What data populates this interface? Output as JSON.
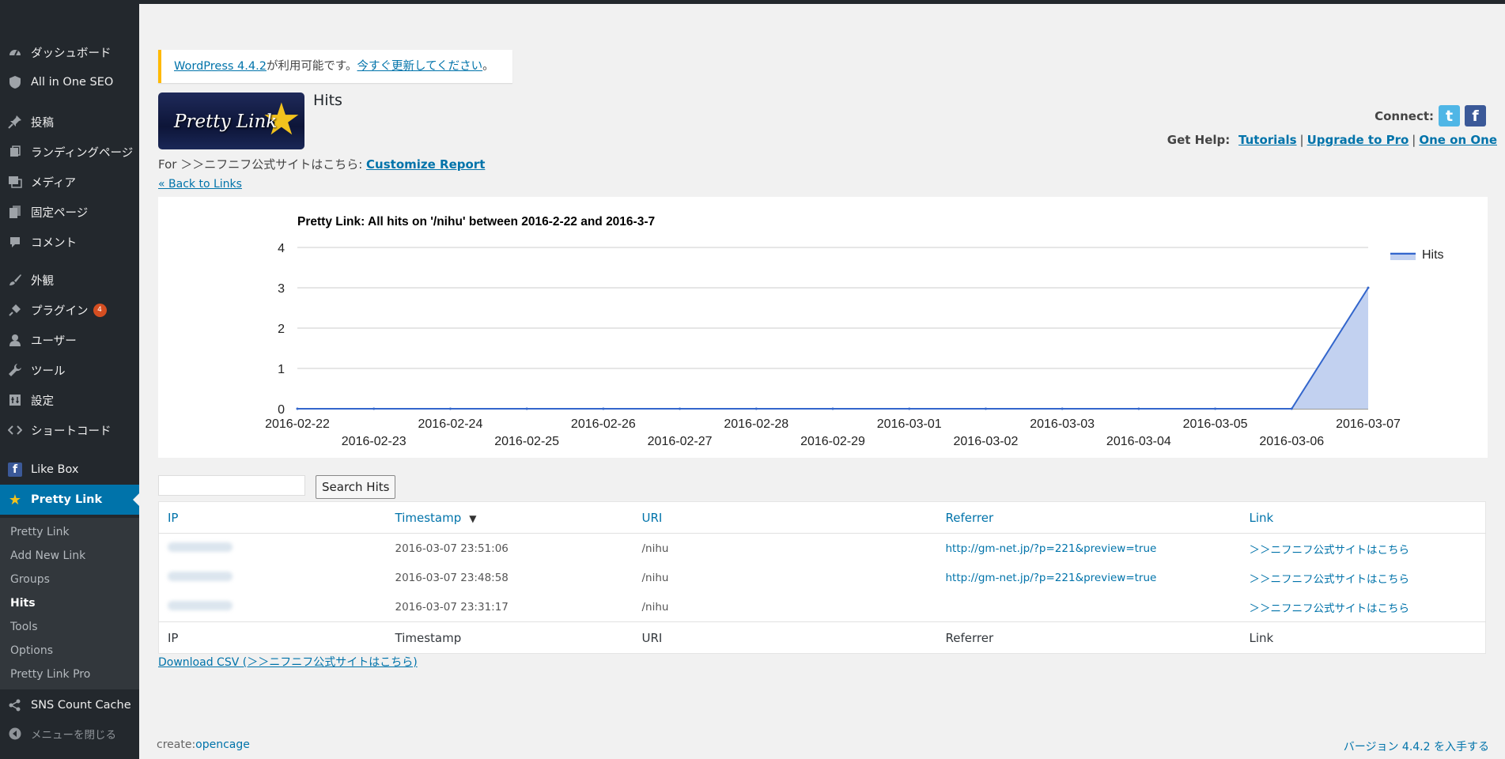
{
  "sidebar": {
    "items": [
      {
        "label": "ダッシュボード",
        "icon": "dashboard-icon"
      },
      {
        "label": "All in One SEO",
        "icon": "shield-icon"
      },
      {
        "label": "投稿",
        "icon": "pushpin-icon"
      },
      {
        "label": "ランディングページ",
        "icon": "page-icon"
      },
      {
        "label": "メディア",
        "icon": "media-icon"
      },
      {
        "label": "固定ページ",
        "icon": "pages-icon"
      },
      {
        "label": "コメント",
        "icon": "comment-icon"
      },
      {
        "label": "外観",
        "icon": "paintbrush-icon"
      },
      {
        "label": "プラグイン",
        "icon": "plugin-icon",
        "badge": "4"
      },
      {
        "label": "ユーザー",
        "icon": "user-icon"
      },
      {
        "label": "ツール",
        "icon": "wrench-icon"
      },
      {
        "label": "設定",
        "icon": "settings-icon"
      },
      {
        "label": "ショートコード",
        "icon": "code-icon"
      },
      {
        "label": "Like Box",
        "icon": "facebook-icon"
      },
      {
        "label": "Pretty Link",
        "icon": "star-icon"
      },
      {
        "label": "SNS Count Cache",
        "icon": "share-icon"
      },
      {
        "label": "メニューを閉じる",
        "icon": "collapse-icon"
      }
    ],
    "submenu": [
      "Pretty Link",
      "Add New Link",
      "Groups",
      "Hits",
      "Tools",
      "Options",
      "Pretty Link Pro"
    ],
    "active_submenu": "Hits"
  },
  "notice": {
    "link_version": "WordPress 4.4.2",
    "text": "が利用可能です。",
    "link_update": "今すぐ更新してください",
    "end": "。"
  },
  "logo": {
    "text": "Pretty Link"
  },
  "page": {
    "title": "Hits",
    "connect_label": "Connect:",
    "help_label": "Get Help:",
    "help_links": [
      "Tutorials",
      "Upgrade to Pro",
      "One on One"
    ],
    "for_prefix": "For ＞＞ニフニフ公式サイトはこちら:",
    "customize_link": "Customize Report",
    "back_link": "« Back to Links"
  },
  "chart_data": {
    "type": "area",
    "title": "Pretty Link: All hits on '/nihu' between 2016-2-22 and 2016-3-7",
    "x": [
      "2016-02-22",
      "2016-02-23",
      "2016-02-24",
      "2016-02-25",
      "2016-02-26",
      "2016-02-27",
      "2016-02-28",
      "2016-02-29",
      "2016-03-01",
      "2016-03-02",
      "2016-03-03",
      "2016-03-04",
      "2016-03-05",
      "2016-03-06",
      "2016-03-07"
    ],
    "series": [
      {
        "name": "Hits",
        "values": [
          0,
          0,
          0,
          0,
          0,
          0,
          0,
          0,
          0,
          0,
          0,
          0,
          0,
          0,
          3
        ]
      }
    ],
    "ylim": [
      0,
      4
    ],
    "yticks": [
      0,
      1,
      2,
      3,
      4
    ],
    "grid": true,
    "legend": "right",
    "colors": {
      "line": "#3366cc",
      "fill": "#c2d1f0"
    }
  },
  "search": {
    "placeholder": "",
    "button": "Search Hits"
  },
  "table": {
    "columns": [
      "IP",
      "Timestamp",
      "URI",
      "Referrer",
      "Link"
    ],
    "sort_arrow": "▼",
    "rows": [
      {
        "ip": "",
        "timestamp": "2016-03-07 23:51:06",
        "uri": "/nihu",
        "referrer": "http://gm-net.jp/?p=221&preview=true",
        "link": "＞＞ニフニフ公式サイトはこちら"
      },
      {
        "ip": "",
        "timestamp": "2016-03-07 23:48:58",
        "uri": "/nihu",
        "referrer": "http://gm-net.jp/?p=221&preview=true",
        "link": "＞＞ニフニフ公式サイトはこちら"
      },
      {
        "ip": "",
        "timestamp": "2016-03-07 23:31:17",
        "uri": "/nihu",
        "referrer": "",
        "link": "＞＞ニフニフ公式サイトはこちら"
      }
    ]
  },
  "csv_link": "Download CSV (＞＞ニフニフ公式サイトはこちら)",
  "footer": {
    "create_label": "create:",
    "create_link": "opencage",
    "version_link": "バージョン 4.4.2 を入手する"
  }
}
